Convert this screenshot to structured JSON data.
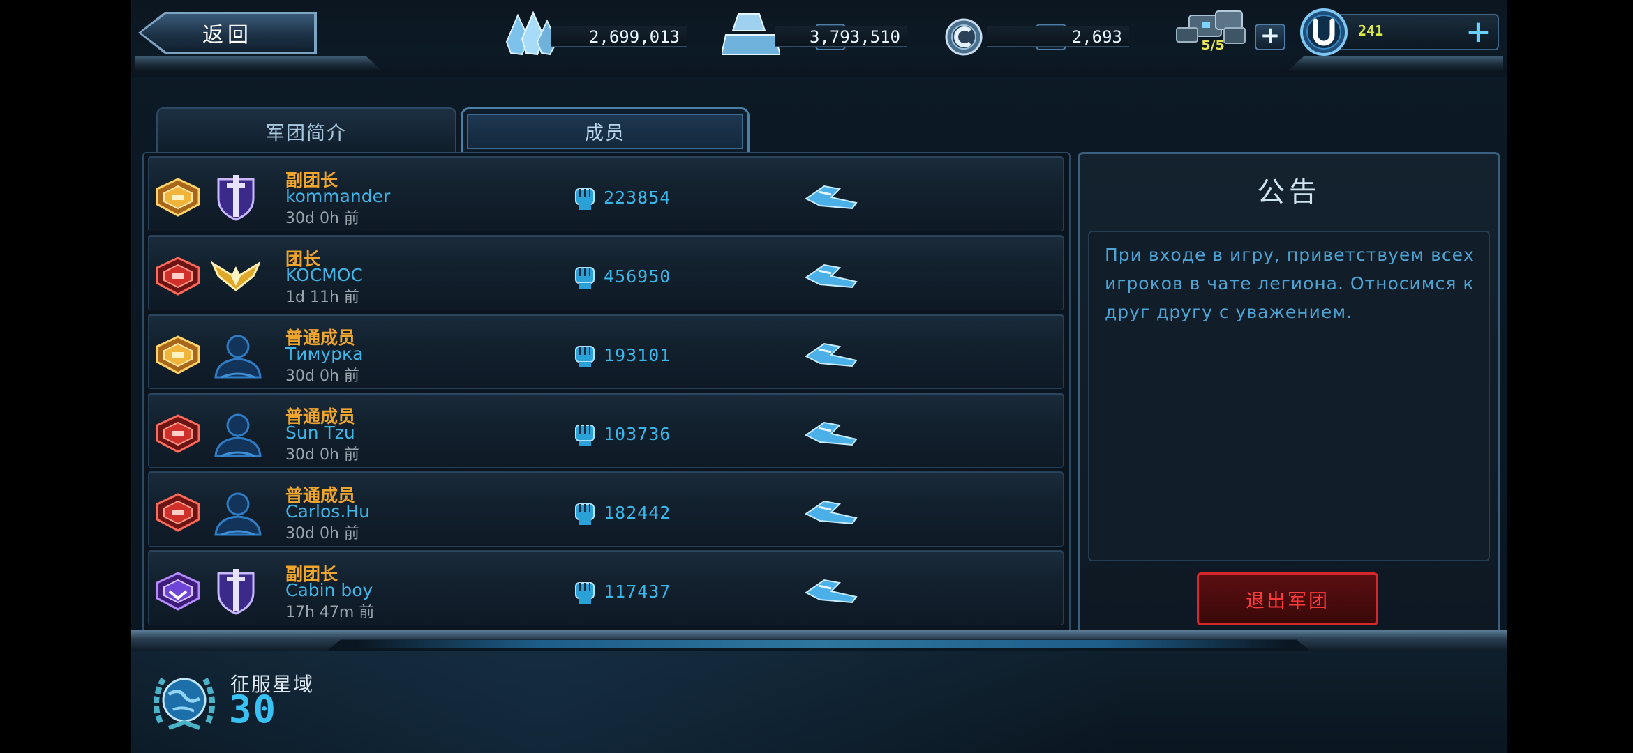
{
  "header": {
    "back_label": "返回",
    "crystal_amount": "2,699,013",
    "metal_amount": "3,793,510",
    "credit_amount": "2,693",
    "energy_count": "5/5",
    "u_amount": "241",
    "plus_symbol": "+"
  },
  "tabs": [
    {
      "label": "军团简介",
      "active": false
    },
    {
      "label": "成员",
      "active": true
    }
  ],
  "members": [
    {
      "role": "副团长",
      "name": "kommander",
      "last_seen": "30d 0h  前",
      "power": "223854",
      "rank_badge": "gold-badge-icon",
      "role_icon": "shield-sword-icon"
    },
    {
      "role": "团长",
      "name": "KOCMOC",
      "last_seen": "1d 11h  前",
      "power": "456950",
      "rank_badge": "red-badge-icon",
      "role_icon": "golden-wings-icon"
    },
    {
      "role": "普通成员",
      "name": "Тимурка",
      "last_seen": "30d 0h  前",
      "power": "193101",
      "rank_badge": "gold-badge-icon",
      "role_icon": "member-bust-icon"
    },
    {
      "role": "普通成员",
      "name": "Sun Tzu",
      "last_seen": "30d 0h  前",
      "power": "103736",
      "rank_badge": "red-badge-icon",
      "role_icon": "member-bust-icon"
    },
    {
      "role": "普通成员",
      "name": "Carlos.Hu",
      "last_seen": "30d 0h  前",
      "power": "182442",
      "rank_badge": "red-badge-icon",
      "role_icon": "member-bust-icon"
    },
    {
      "role": "副团长",
      "name": "Cabin boy",
      "last_seen": "17h 47m  前",
      "power": "117437",
      "rank_badge": "purple-badge-icon",
      "role_icon": "shield-sword-icon"
    }
  ],
  "announcement": {
    "title": "公告",
    "text": "При входе в игру, приветствуем всех игроков в чате легиона. Относимся к друг другу с уважением.",
    "leave_label": "退出军团"
  },
  "footer": {
    "conquest_label": "征服星域",
    "conquest_count": "30"
  },
  "colors": {
    "role_text": "#f0a52c",
    "name_text": "#3fb5e8",
    "leave_button": "#d6282a"
  }
}
